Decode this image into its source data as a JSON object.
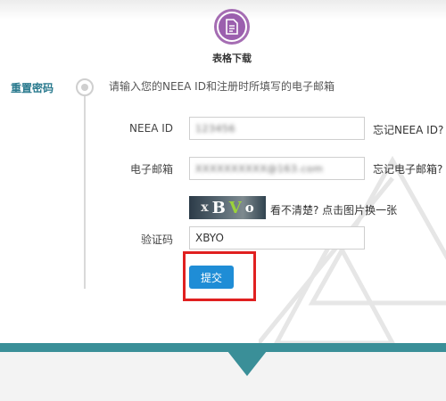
{
  "step": {
    "label": "表格下载",
    "icon": "document-icon",
    "accent": "#9b5fae"
  },
  "side": {
    "section_label": "重置密码"
  },
  "form": {
    "instruction": "请输入您的NEEA ID和注册时所填写的电子邮箱",
    "neea_id": {
      "label": "NEEA ID",
      "value": "123456",
      "aside": "忘记NEEA ID?"
    },
    "email": {
      "label": "电子邮箱",
      "value": "XXXXXXXXXX@163.com",
      "aside": "忘记电子邮箱?"
    },
    "captcha": {
      "image_text": [
        "x",
        "B",
        "V",
        "o"
      ],
      "hint": "看不清楚? 点击图片换一张",
      "label": "验证码",
      "value": "XBYO"
    },
    "submit_label": "提交"
  },
  "colors": {
    "teal": "#3a8f98",
    "button": "#1f8dd6",
    "highlight": "#e02020",
    "section_label": "#2a7a8e"
  }
}
